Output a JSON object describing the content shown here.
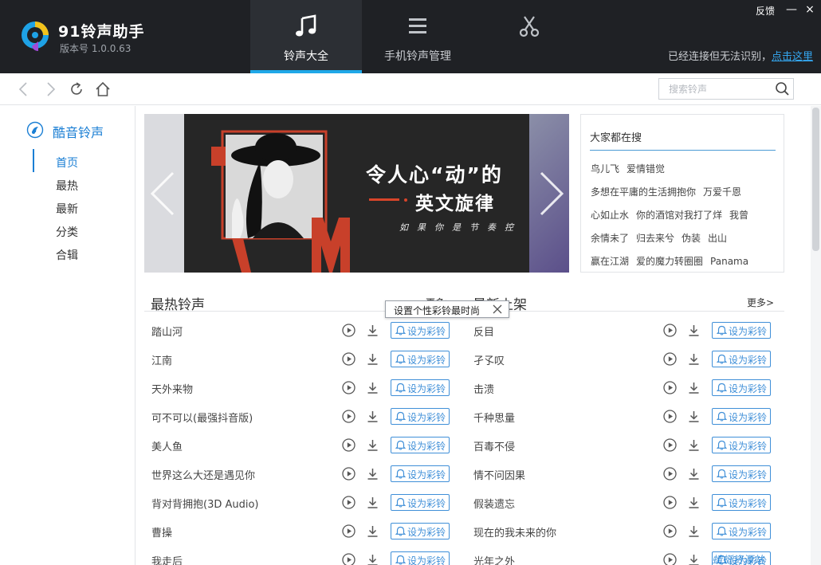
{
  "app": {
    "title": "91铃声助手",
    "version": "版本号 1.0.0.63"
  },
  "nav": {
    "tabs": [
      {
        "label": "铃声大全",
        "icon": "music-note-icon",
        "active": true
      },
      {
        "label": "手机铃声管理",
        "icon": "menu-lines-icon",
        "active": false
      },
      {
        "label": "",
        "icon": "scissors-icon",
        "active": false
      }
    ]
  },
  "window": {
    "feedback": "反馈",
    "minimize": "—",
    "close": "×"
  },
  "connection": {
    "status": "已经连接但无法识别，",
    "link": "点击这里"
  },
  "search": {
    "placeholder": "搜索铃声"
  },
  "sidebar": {
    "heading": "酷音铃声",
    "items": [
      "首页",
      "最热",
      "最新",
      "分类",
      "合辑"
    ],
    "active_index": 0
  },
  "banner": {
    "headline": "令人心“动”的",
    "subline": "英文旋律",
    "tagline": "如果你是节奏控",
    "letter": "M"
  },
  "hot_search": {
    "title": "大家都在搜",
    "rows": [
      [
        "鸟儿飞",
        "爱情错觉"
      ],
      [
        "多想在平庸的生活拥抱你",
        "万爱千恩"
      ],
      [
        "心如止水",
        "你的酒馆对我打了烊",
        "我曾"
      ],
      [
        "余情未了",
        "归去来兮",
        "伪装",
        "出山"
      ],
      [
        "赢在江湖",
        "爱的魔力转圈圈",
        "Panama"
      ]
    ]
  },
  "hot_list": {
    "title": "最热铃声",
    "more": "更多>",
    "songs": [
      "踏山河",
      "江南",
      "天外来物",
      "可不可以(最强抖音版)",
      "美人鱼",
      "世界这么大还是遇见你",
      "背对背拥抱(3D Audio)",
      "曹操",
      "我走后"
    ]
  },
  "new_list": {
    "title": "最新上架",
    "more": "更多>",
    "songs": [
      "反目",
      "孑孓叹",
      "击溃",
      "千种思量",
      "百毒不侵",
      "情不问因果",
      "假装遗忘",
      "现在的我未来的你",
      "光年之外"
    ]
  },
  "set_button_label": "设为彩铃",
  "tooltip": {
    "text": "设置个性彩铃最时尚"
  },
  "watermark": "蜻蜓资源站",
  "colors": {
    "topbar": "#1f2125",
    "accent": "#1fa8e8",
    "link": "#1b7fd4"
  }
}
